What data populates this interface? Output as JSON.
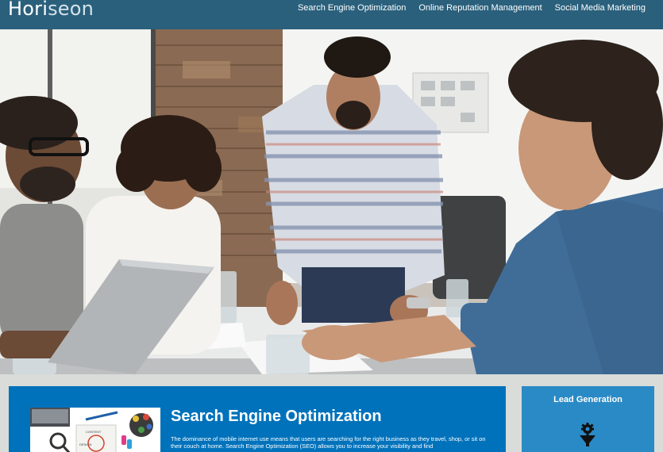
{
  "brand": {
    "name_part1": "Hori",
    "name_part2": "seon"
  },
  "nav": {
    "items": [
      {
        "label": "Search Engine Optimization"
      },
      {
        "label": "Online Reputation Management"
      },
      {
        "label": "Social Media Marketing"
      }
    ]
  },
  "seo_section": {
    "title": "Search Engine Optimization",
    "text": "The dominance of mobile internet use means that users are searching for the right business as they travel, shop, or sit on their couch at home. Search Engine Optimization (SEO) allows you to increase your visibility and find"
  },
  "lead_section": {
    "title": "Lead Generation",
    "icon": "funnel-gear-icon"
  },
  "colors": {
    "header": "#2a607c",
    "seo_card": "#0072bb",
    "lead_card": "#2a8ac5",
    "page_bg": "#d9dcd9"
  }
}
